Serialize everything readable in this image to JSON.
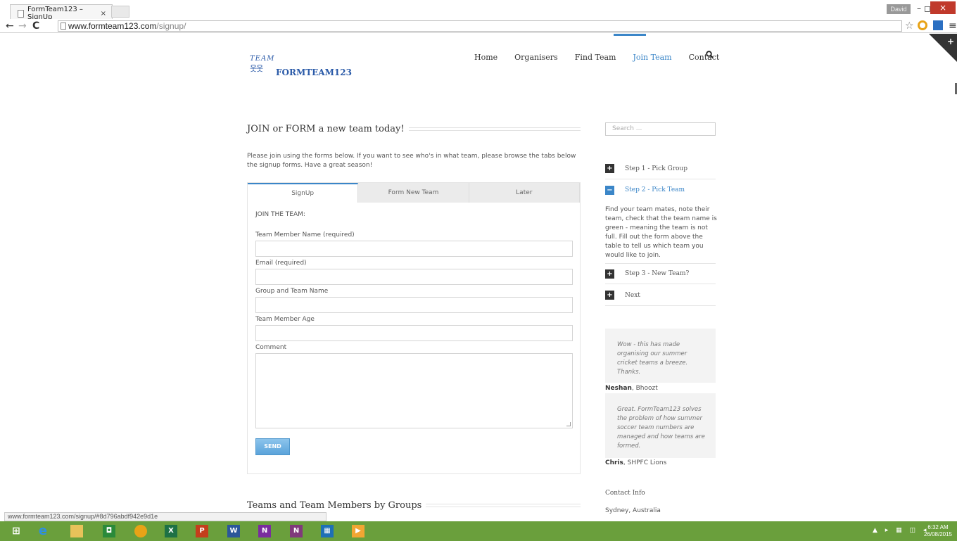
{
  "browser": {
    "tab_title": "FormTeam123 – SignUp",
    "tab_close": "×",
    "url_host": "www.formteam123.com",
    "url_path": "/signup/",
    "user_badge": "David",
    "minimize": "–",
    "maximize": "◻",
    "close": "×",
    "back": "←",
    "forward": "→",
    "reload": "C",
    "star": "☆",
    "menu": "≡",
    "status_url": "www.formteam123.com/signup/#8d796abdf942e9d1e"
  },
  "site": {
    "logo_team": "TEAM",
    "logo_name": "FORMTEAM123",
    "corner_plus": "+",
    "nav": [
      {
        "label": "Home"
      },
      {
        "label": "Organisers"
      },
      {
        "label": "Find Team"
      },
      {
        "label": "Join Team"
      },
      {
        "label": "Contact"
      }
    ],
    "search_glyph": "🔍"
  },
  "main": {
    "title": "JOIN or FORM a new team today!",
    "intro": "Please join using the forms below. If you want to see who's in what team, please browse the tabs below the signup forms. Have a great season!",
    "tabs": [
      {
        "label": "SignUp"
      },
      {
        "label": "Form New Team"
      },
      {
        "label": "Later"
      }
    ],
    "form": {
      "heading": "JOIN THE TEAM:",
      "field_name": "Team Member Name (required)",
      "field_email": "Email (required)",
      "field_group": "Group and Team Name",
      "field_age": "Team Member Age",
      "field_comment": "Comment",
      "send_label": "SEND"
    },
    "section2_title": "Teams and Team Members by Groups"
  },
  "sidebar": {
    "search_placeholder": "Search ...",
    "accordion": [
      {
        "icon": "+",
        "label": "Step 1 - Pick Group"
      },
      {
        "icon": "−",
        "label": "Step 2 - Pick Team"
      },
      {
        "icon": "+",
        "label": "Step 3 - New Team?"
      },
      {
        "icon": "+",
        "label": "Next"
      }
    ],
    "step2_body": "Find your team mates, note their team, check that the team name is green - meaning the team is not full. Fill out the form above the table to tell us which team you would like to join.",
    "testimonials": [
      {
        "quote": "Wow - this has made organising our summer cricket teams a breeze. Thanks.",
        "name": "Neshan",
        "org": ", Bhoozt"
      },
      {
        "quote": "Great. FormTeam123 solves the problem of how summer soccer team numbers are managed and how teams are formed.",
        "name": "Chris",
        "org": ", SHPFC Lions"
      }
    ],
    "contact_heading": "Contact Info",
    "contact_location": "Sydney, Australia"
  },
  "taskbar": {
    "time": "6:32 AM",
    "date": "26/08/2015"
  },
  "colors": {
    "accent": "#3b86c8",
    "taskbar": "#6a9f3c",
    "close": "#c0392b"
  }
}
